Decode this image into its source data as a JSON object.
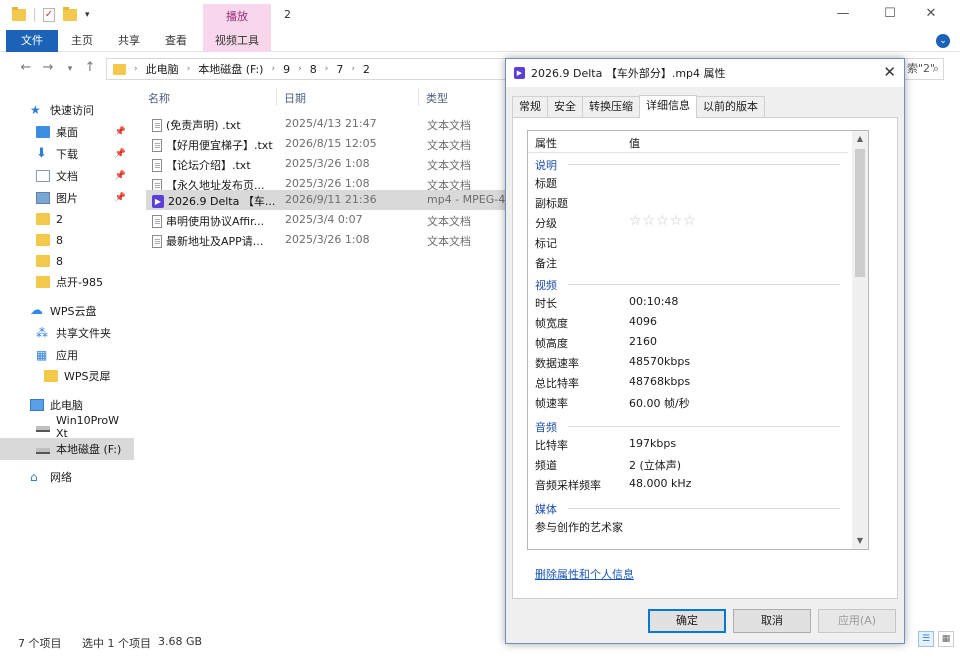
{
  "explorer": {
    "title": "2",
    "context_tab_label": "播放",
    "ribbon_tabs": [
      "文件",
      "主页",
      "共享",
      "查看",
      "视频工具"
    ],
    "path": [
      "此电脑",
      "本地磁盘 (F:)",
      "9",
      "8",
      "7",
      "2"
    ],
    "search_partial": "索\"2\"",
    "columns": {
      "name": "名称",
      "date": "日期",
      "type": "类型"
    },
    "sidebar": [
      {
        "label": "快速访问",
        "icon": "star-icon"
      },
      {
        "label": "桌面",
        "icon": "desktop-icon",
        "pinned": true
      },
      {
        "label": "下载",
        "icon": "download-icon",
        "pinned": true
      },
      {
        "label": "文档",
        "icon": "document-icon",
        "pinned": true
      },
      {
        "label": "图片",
        "icon": "picture-icon",
        "pinned": true
      },
      {
        "label": "2",
        "icon": "folder-icon"
      },
      {
        "label": "8",
        "icon": "folder-icon"
      },
      {
        "label": "8",
        "icon": "folder-icon"
      },
      {
        "label": "点开-985",
        "icon": "folder-icon"
      },
      {
        "label": "WPS云盘",
        "icon": "cloud-icon"
      },
      {
        "label": "共享文件夹",
        "icon": "share-icon"
      },
      {
        "label": "应用",
        "icon": "apps-icon"
      },
      {
        "label": "WPS灵犀",
        "icon": "folder-icon"
      },
      {
        "label": "此电脑",
        "icon": "computer-icon"
      },
      {
        "label": "Win10ProW Xt",
        "icon": "drive-icon"
      },
      {
        "label": "本地磁盘 (F:)",
        "icon": "drive-icon",
        "selected": true
      },
      {
        "label": "网络",
        "icon": "network-icon"
      }
    ],
    "files": [
      {
        "name": "(免责声明) .txt",
        "date": "2025/4/13 21:47",
        "type": "文本文档",
        "icon": "txt"
      },
      {
        "name": "【好用便宜梯子】.txt",
        "date": "2026/8/15 12:05",
        "type": "文本文档",
        "icon": "txt"
      },
      {
        "name": "【论坛介绍】.txt",
        "date": "2025/3/26 1:08",
        "type": "文本文档",
        "icon": "txt"
      },
      {
        "name": "【永久地址发布页...",
        "date": "2025/3/26 1:08",
        "type": "文本文档",
        "icon": "txt"
      },
      {
        "name": "2026.9 Delta 【车...",
        "date": "2026/9/11 21:36",
        "type": "mp4 - MPEG-4",
        "icon": "mp4",
        "selected": true
      },
      {
        "name": "串明使用协议Affir...",
        "date": "2025/3/4 0:07",
        "type": "文本文档",
        "icon": "txt"
      },
      {
        "name": "最新地址及APP请...",
        "date": "2025/3/26 1:08",
        "type": "文本文档",
        "icon": "txt"
      }
    ],
    "status": {
      "count": "7 个项目",
      "selected": "选中 1 个项目",
      "size": "3.68 GB"
    }
  },
  "dialog": {
    "title": "2026.9 Delta 【车外部分】.mp4 属性",
    "tabs": [
      "常规",
      "安全",
      "转换压缩",
      "详细信息",
      "以前的版本"
    ],
    "active_tab": "详细信息",
    "header": {
      "key": "属性",
      "value": "值"
    },
    "sections": [
      {
        "title": "说明",
        "rows": [
          {
            "k": "标题",
            "v": ""
          },
          {
            "k": "副标题",
            "v": ""
          },
          {
            "k": "分级",
            "v": "stars"
          },
          {
            "k": "标记",
            "v": ""
          },
          {
            "k": "备注",
            "v": ""
          }
        ]
      },
      {
        "title": "视频",
        "rows": [
          {
            "k": "时长",
            "v": "00:10:48"
          },
          {
            "k": "帧宽度",
            "v": "4096"
          },
          {
            "k": "帧高度",
            "v": "2160"
          },
          {
            "k": "数据速率",
            "v": "48570kbps"
          },
          {
            "k": "总比特率",
            "v": "48768kbps"
          },
          {
            "k": "帧速率",
            "v": "60.00 帧/秒"
          }
        ]
      },
      {
        "title": "音频",
        "rows": [
          {
            "k": "比特率",
            "v": "197kbps"
          },
          {
            "k": "频道",
            "v": "2 (立体声)"
          },
          {
            "k": "音频采样频率",
            "v": "48.000 kHz"
          }
        ]
      },
      {
        "title": "媒体",
        "rows": [
          {
            "k": "参与创作的艺术家",
            "v": ""
          }
        ]
      }
    ],
    "rating": {
      "stars": 0,
      "max": 5
    },
    "remove_link": "删除属性和个人信息",
    "buttons": {
      "ok": "确定",
      "cancel": "取消",
      "apply": "应用(A)"
    }
  }
}
